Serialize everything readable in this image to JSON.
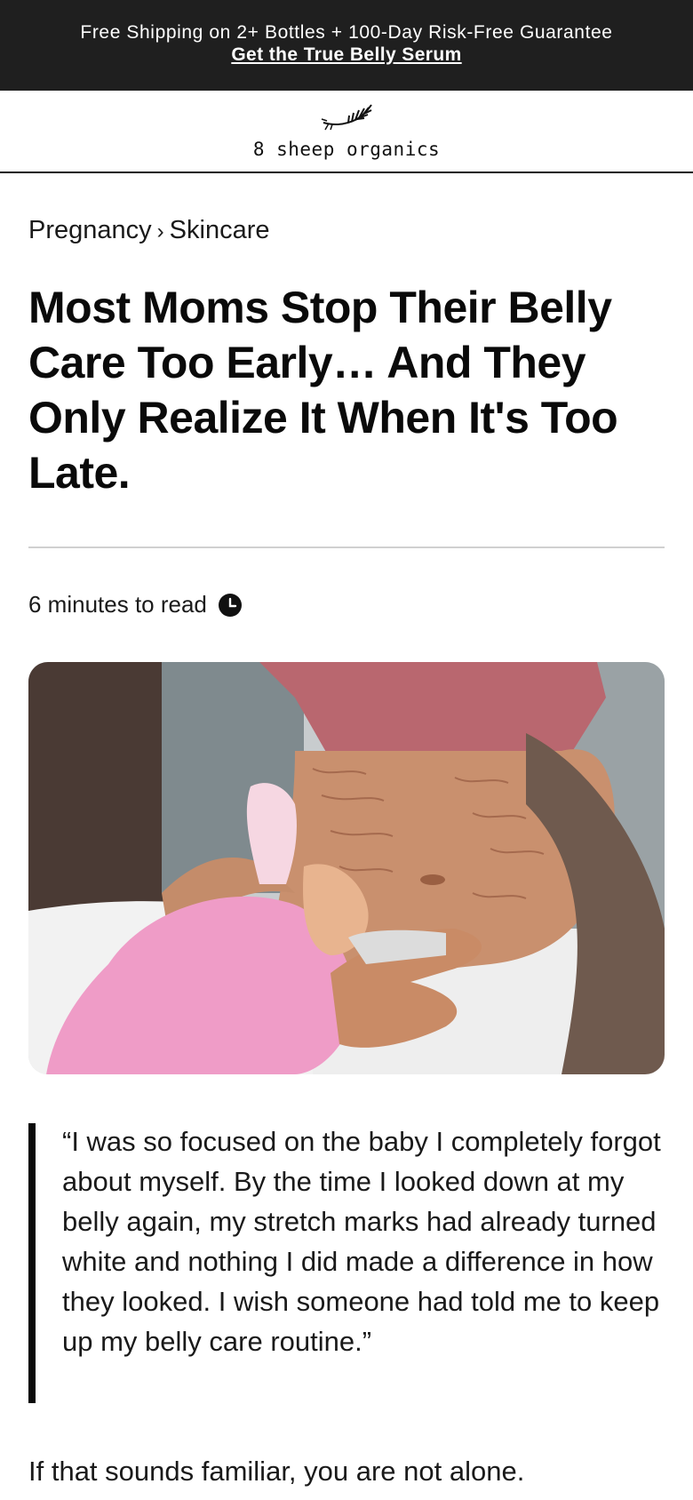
{
  "announcement": {
    "text": "Free Shipping on 2+ Bottles + 100-Day Risk-Free Guarantee",
    "link_label": "Get the True Belly Serum"
  },
  "header": {
    "logo_icon": "feather-icon",
    "brand": "8 sheep organics"
  },
  "breadcrumb": {
    "items": [
      "Pregnancy",
      "Skincare"
    ],
    "separator": "›"
  },
  "article": {
    "title": "Most Moms Stop Their Belly Care Too Early… And They Only Realize It When It's Too Late.",
    "read_time": "6 minutes to read",
    "read_time_icon": "clock-icon",
    "hero_image_alt": "hero-photo",
    "quote": "“I was so focused on the baby I completely forgot about myself. By the time I looked down at my belly again, my stretch marks had already turned white and nothing I did made a difference in how they looked. I wish someone had told me to keep up my belly care routine.”",
    "paragraph_1": "If that sounds familiar, you are not alone."
  },
  "colors": {
    "announcement_bg": "#1f1f1f",
    "text": "#111111",
    "divider": "#d0d0d0",
    "quote_bar": "#0a0a0a"
  }
}
